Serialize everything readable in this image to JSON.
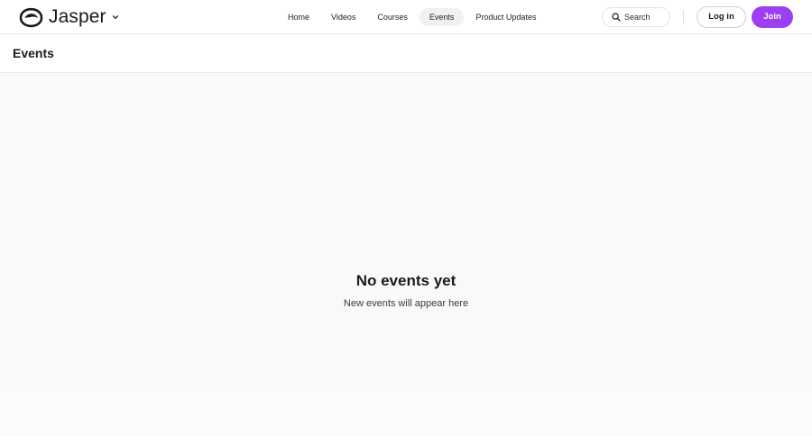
{
  "brand": {
    "name": "Jasper",
    "logo_icon": "jasper-logo-icon",
    "menu_icon": "chevron-down-icon"
  },
  "nav": {
    "items": [
      {
        "label": "Home",
        "active": false
      },
      {
        "label": "Videos",
        "active": false
      },
      {
        "label": "Courses",
        "active": false
      },
      {
        "label": "Events",
        "active": true
      },
      {
        "label": "Product Updates",
        "active": false
      }
    ]
  },
  "search": {
    "placeholder": "Search",
    "icon": "search-icon"
  },
  "auth": {
    "login_label": "Log in",
    "join_label": "Join"
  },
  "page": {
    "title": "Events"
  },
  "empty_state": {
    "title": "No events yet",
    "subtitle": "New events will appear here"
  },
  "colors": {
    "accent": "#9b3ff0",
    "background": "#f9f9f9",
    "active_nav_bg": "#f1f1f1"
  }
}
